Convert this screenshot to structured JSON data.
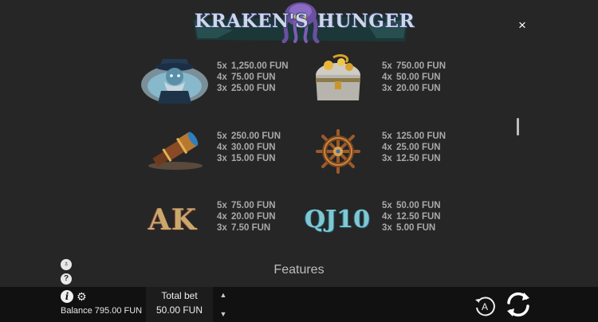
{
  "logo": {
    "left": "KRAKEN'S",
    "right": "HUNGER"
  },
  "close_icon": "×",
  "paytable": [
    {
      "symbol": "pirate-captain",
      "pays": [
        {
          "mult": "5x",
          "amount": "1,250.00 FUN"
        },
        {
          "mult": "4x",
          "amount": "75.00 FUN"
        },
        {
          "mult": "3x",
          "amount": "25.00 FUN"
        }
      ]
    },
    {
      "symbol": "treasure-chest",
      "pays": [
        {
          "mult": "5x",
          "amount": "750.00 FUN"
        },
        {
          "mult": "4x",
          "amount": "50.00 FUN"
        },
        {
          "mult": "3x",
          "amount": "20.00 FUN"
        }
      ]
    },
    {
      "symbol": "spyglass",
      "pays": [
        {
          "mult": "5x",
          "amount": "250.00 FUN"
        },
        {
          "mult": "4x",
          "amount": "30.00 FUN"
        },
        {
          "mult": "3x",
          "amount": "15.00 FUN"
        }
      ]
    },
    {
      "symbol": "ships-wheel",
      "pays": [
        {
          "mult": "5x",
          "amount": "125.00 FUN"
        },
        {
          "mult": "4x",
          "amount": "25.00 FUN"
        },
        {
          "mult": "3x",
          "amount": "12.50 FUN"
        }
      ]
    },
    {
      "symbol": "letters-a-k",
      "letters": "AK",
      "pays": [
        {
          "mult": "5x",
          "amount": "75.00 FUN"
        },
        {
          "mult": "4x",
          "amount": "20.00 FUN"
        },
        {
          "mult": "3x",
          "amount": "7.50 FUN"
        }
      ]
    },
    {
      "symbol": "letters-q-j-10",
      "letters": "QJ10",
      "pays": [
        {
          "mult": "5x",
          "amount": "50.00 FUN"
        },
        {
          "mult": "4x",
          "amount": "12.50 FUN"
        },
        {
          "mult": "3x",
          "amount": "5.00 FUN"
        }
      ]
    }
  ],
  "features_title": "Features",
  "side_icons": {
    "fairness": "♁",
    "help": "?"
  },
  "bottom": {
    "info": "i",
    "gear": "⚙",
    "balance": "Balance 795.00 FUN",
    "total_bet_label": "Total bet",
    "total_bet_value": "50.00 FUN",
    "bet_up": "▲",
    "bet_down": "▼",
    "auto_label": "A"
  }
}
